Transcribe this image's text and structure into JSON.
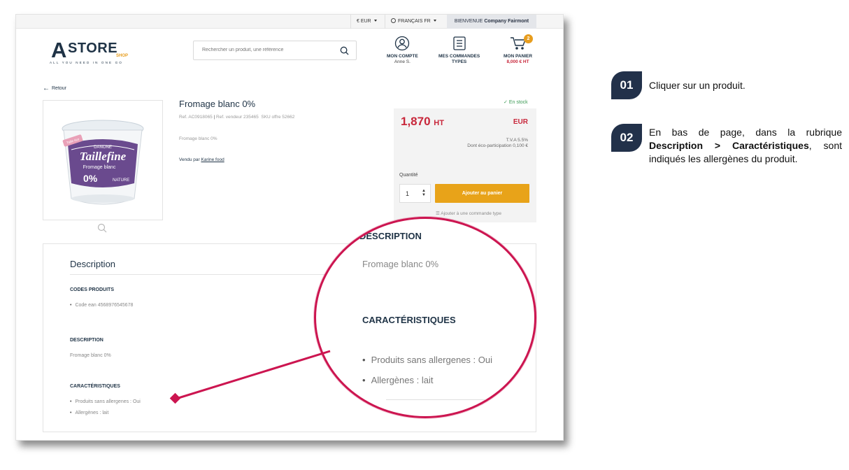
{
  "topbar": {
    "currency": "€ EUR",
    "language": "FRANÇAIS FR",
    "welcome_prefix": "BIENVENUE",
    "welcome_company": "Company Fairmont"
  },
  "logo": {
    "a": "A",
    "store": "STORE",
    "shop": "SHOP",
    "tagline": "ALL YOU NEED IN ONE GO"
  },
  "search": {
    "placeholder": "Rechercher un produit, une référence"
  },
  "header": {
    "account_label": "MON COMPTE",
    "account_user": "Anne S.",
    "orders_label_1": "MES COMMANDES",
    "orders_label_2": "TYPES",
    "cart_label": "MON PANIER",
    "cart_total": "8,000 € HT",
    "cart_count": "2"
  },
  "back_label": "Retour",
  "product": {
    "title": "Fromage blanc 0%",
    "ref": "Ref. AC0918065",
    "vendor_ref": "Ref. vendeur 235465",
    "sku": "SKU offre 52662",
    "short_desc": "Fromage blanc 0%",
    "sold_by_prefix": "Vendu par",
    "seller": "Karine food",
    "stock": "En stock",
    "image": {
      "brand": "DANONE",
      "name": "Taillefine",
      "label": "Fromage blanc",
      "percent": "0%",
      "variant": "NATURE",
      "ribbon": "Taille éco"
    }
  },
  "pricebox": {
    "price": "1,870",
    "price_suffix": "HT",
    "currency": "EUR",
    "tva": "T.V.A 5.5%",
    "eco": "Dont éco-participation 0,100 €",
    "qty_label": "Quantité",
    "qty_value": "1",
    "add_button": "Ajouter au panier",
    "add_to_order": "Ajouter à une commande type"
  },
  "description": {
    "title": "Description",
    "codes_title": "CODES PRODUITS",
    "codes_item": "Code ean 4568976545678",
    "desc_title": "DESCRIPTION",
    "desc_value": "Fromage blanc 0%",
    "car_title": "CARACTÉRISTIQUES",
    "car_items": [
      "Produits sans allergenes : Oui",
      "Allergènes : lait"
    ]
  },
  "magnifier": {
    "desc_title": "DESCRIPTION",
    "desc_value": "Fromage blanc 0%",
    "car_title": "CARACTÉRISTIQUES",
    "car_items": [
      "Produits sans allergenes : Oui",
      "Allergènes : lait"
    ]
  },
  "steps": [
    {
      "num": "01",
      "text": "Cliquer sur un produit."
    },
    {
      "num": "02",
      "text_before": "En bas de page, dans la rubrique",
      "text_bold": "Description > Caractéristiques",
      "text_after": ", sont indiqués les allergènes du produit."
    }
  ],
  "colors": {
    "navy": "#1f3346",
    "accent_orange": "#e8a319",
    "price_red": "#c8273b",
    "highlight_pink": "#cc1550",
    "step_badge": "#22314a",
    "stock_green": "#3c9a55"
  }
}
